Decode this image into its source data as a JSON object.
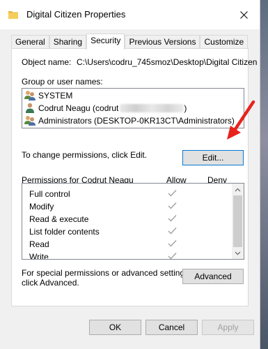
{
  "window": {
    "title": "Digital Citizen Properties",
    "close_glyph": "✕"
  },
  "tabs": [
    "General",
    "Sharing",
    "Security",
    "Previous Versions",
    "Customize"
  ],
  "active_tab": "Security",
  "object": {
    "label": "Object name:",
    "value": "C:\\Users\\codru_745smoz\\Desktop\\Digital Citizen"
  },
  "groups": {
    "label": "Group or user names:",
    "users": [
      {
        "name": "SYSTEM",
        "icon": "group-users-icon"
      },
      {
        "name": "Codrut Neagu (codrut",
        "suffix": ")",
        "icon": "single-user-icon"
      },
      {
        "name": "Administrators (DESKTOP-0KR13CT\\Administrators)",
        "icon": "group-users-icon"
      }
    ]
  },
  "change_hint": "To change permissions, click Edit.",
  "edit_button": "Edit...",
  "permissions": {
    "label": "Permissions for Codrut Neagu",
    "allow_header": "Allow",
    "deny_header": "Deny",
    "rows": [
      {
        "name": "Full control",
        "allow": true,
        "deny": false
      },
      {
        "name": "Modify",
        "allow": true,
        "deny": false
      },
      {
        "name": "Read & execute",
        "allow": true,
        "deny": false
      },
      {
        "name": "List folder contents",
        "allow": true,
        "deny": false
      },
      {
        "name": "Read",
        "allow": true,
        "deny": false
      },
      {
        "name": "Write",
        "allow": true,
        "deny": false
      }
    ]
  },
  "advanced": {
    "hint_line1": "For special permissions or advanced settings,",
    "hint_line2": "click Advanced.",
    "button": "Advanced"
  },
  "footer": {
    "ok": "OK",
    "cancel": "Cancel",
    "apply": "Apply"
  },
  "colors": {
    "accent_border": "#0078d7",
    "annotation_arrow": "#e8231c",
    "check_gray": "#a0a0a0"
  }
}
